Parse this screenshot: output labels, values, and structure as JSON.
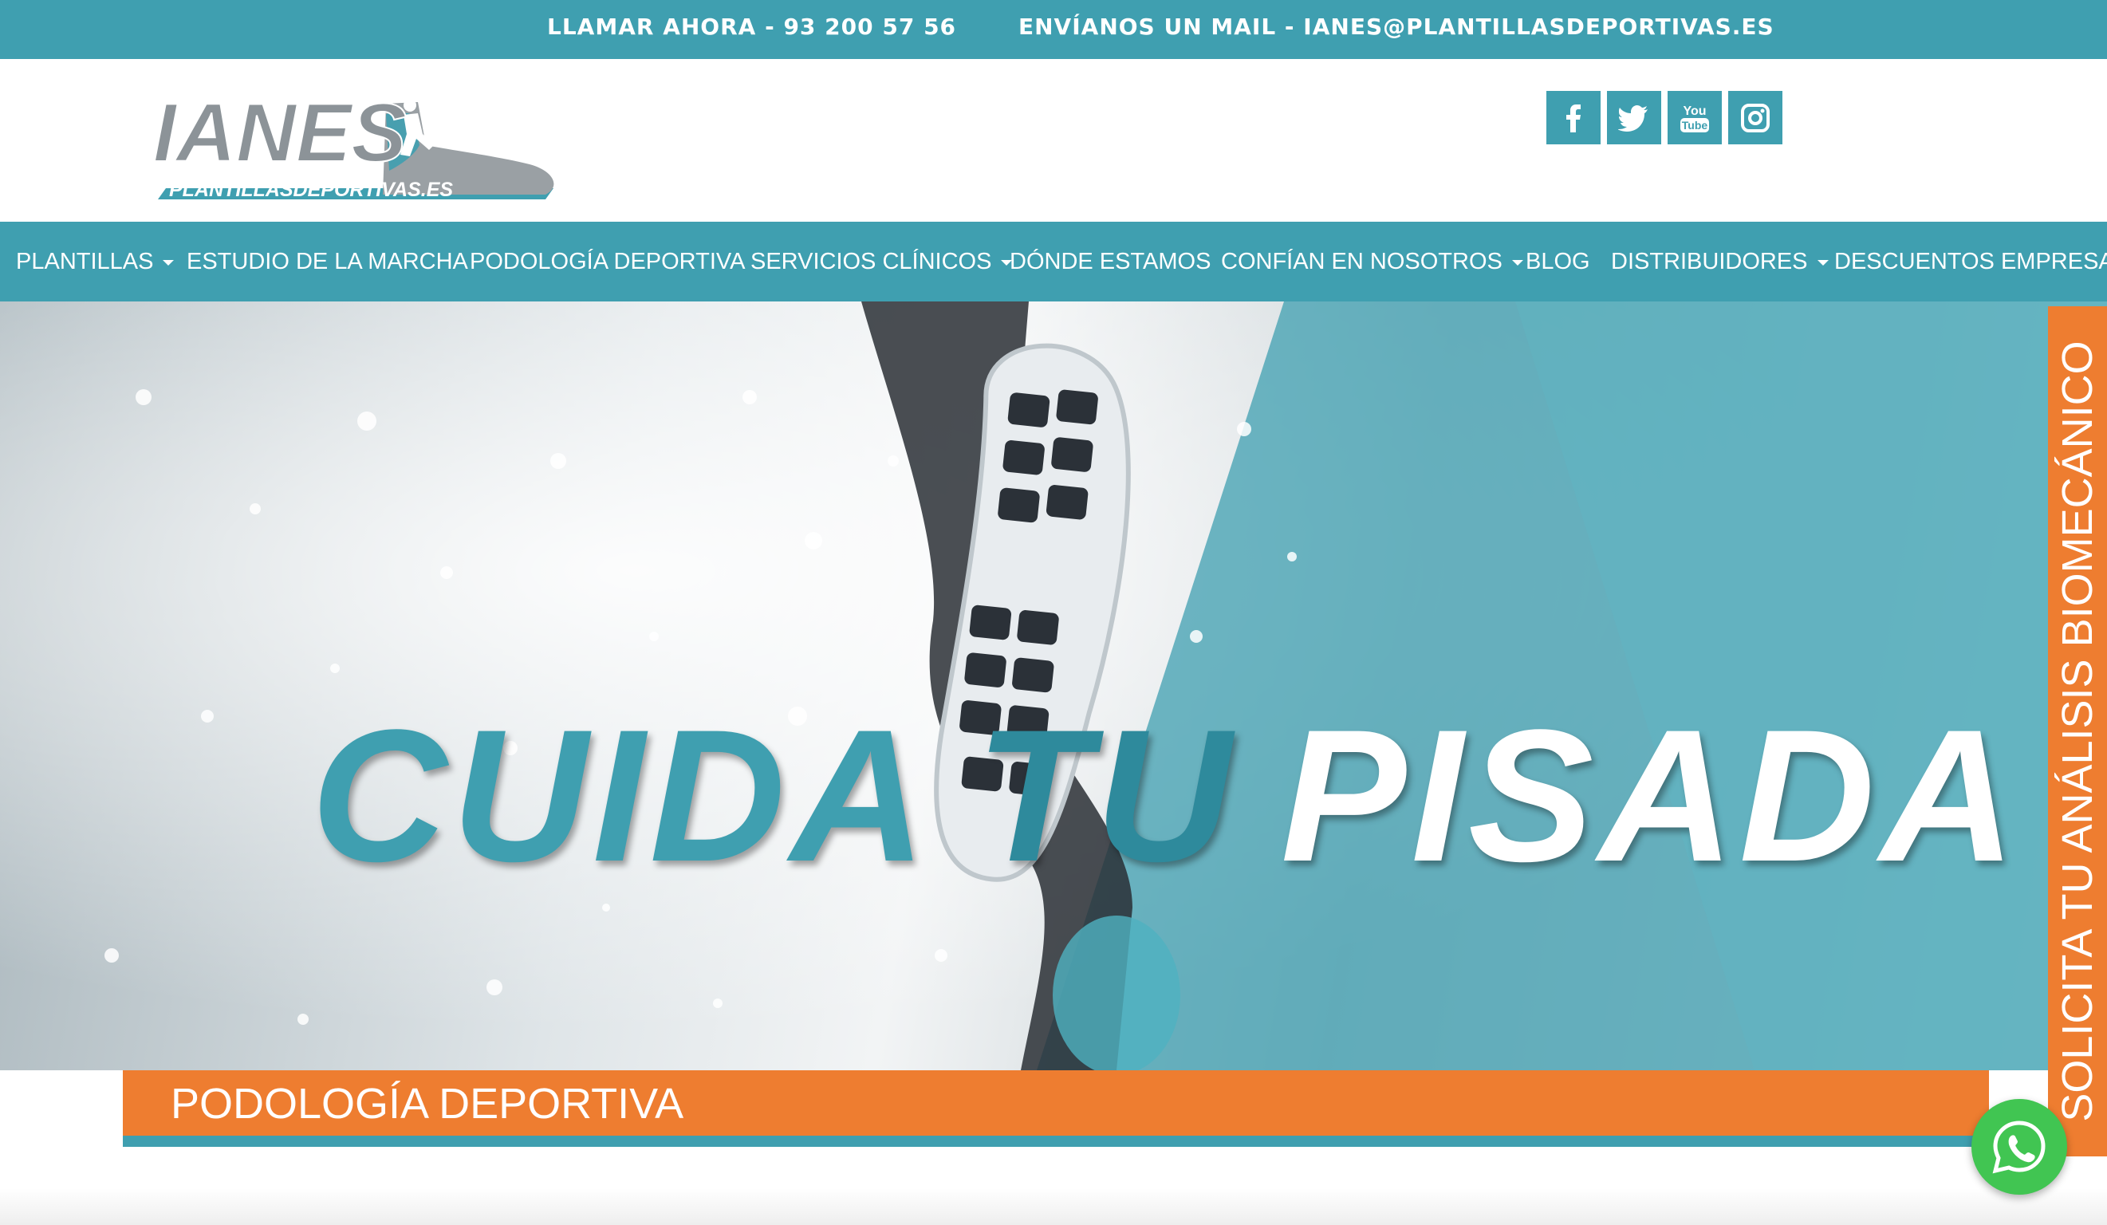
{
  "topbar": {
    "call": "LLAMAR AHORA - 93 200 57 56",
    "mail": "ENVÍANOS UN MAIL - IANES@PLANTILLASDEPORTIVAS.ES"
  },
  "logo": {
    "brand": "IANES",
    "sub": "PLANTILLASDEPORTIVAS.ES"
  },
  "social": [
    {
      "icon": "facebook-icon"
    },
    {
      "icon": "twitter-icon"
    },
    {
      "icon": "youtube-icon",
      "text": "You Tube"
    },
    {
      "icon": "instagram-icon"
    }
  ],
  "nav": {
    "items": [
      {
        "label": "PLANTILLAS",
        "dropdown": true
      },
      {
        "label": "ESTUDIO DE LA MARCHA",
        "dropdown": false
      },
      {
        "label": "PODOLOGÍA DEPORTIVA",
        "dropdown": false
      },
      {
        "label": "SERVICIOS CLÍNICOS",
        "dropdown": true
      },
      {
        "label": "DÓNDE ESTAMOS",
        "dropdown": false
      },
      {
        "label": "CONFÍAN EN NOSOTROS",
        "dropdown": true
      },
      {
        "label": "BLOG",
        "dropdown": false
      },
      {
        "label": "DISTRIBUIDORES",
        "dropdown": true
      },
      {
        "label": "DESCUENTOS EMPRESAS",
        "dropdown": false
      }
    ]
  },
  "hero": {
    "words": [
      "CUIDA",
      "TU",
      "PISADA"
    ]
  },
  "banner": {
    "title": "PODOLOGÍA DEPORTIVA"
  },
  "side_cta": {
    "label": "SOLICITA TU ANÁLISIS BIOMECÁNICO"
  },
  "colors": {
    "teal": "#3f9fb0",
    "orange": "#ee7d30",
    "whatsapp": "#41c552"
  }
}
